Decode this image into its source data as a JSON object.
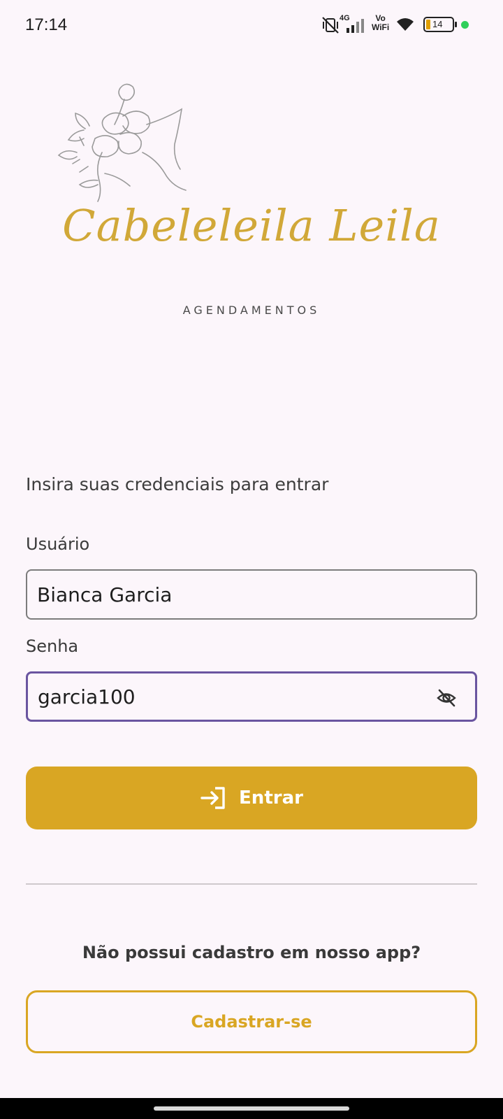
{
  "status_bar": {
    "time": "17:14",
    "network_label": "4G",
    "vowifi_label_top": "Vo",
    "vowifi_label_bottom": "WiFi",
    "battery_level": "14",
    "icons": [
      "mute-vibrate-icon",
      "signal-icon",
      "vowifi-icon",
      "wifi-icon",
      "battery-icon",
      "dot-icon"
    ]
  },
  "logo": {
    "brand_name": "Cabeleleila Leila",
    "subtitle": "AGENDAMENTOS"
  },
  "form": {
    "prompt": "Insira suas credenciais para entrar",
    "username": {
      "label": "Usuário",
      "value": "Bianca Garcia"
    },
    "password": {
      "label": "Senha",
      "value": "garcia100",
      "visibility_icon": "eye-off-icon"
    },
    "submit_label": "Entrar",
    "submit_icon": "login-icon"
  },
  "signup": {
    "question": "Não possui cadastro em nosso app?",
    "button_label": "Cadastrar-se"
  },
  "colors": {
    "background": "#fcf6fb",
    "accent_gold": "#d9a623",
    "focus_purple": "#6a55a0"
  }
}
